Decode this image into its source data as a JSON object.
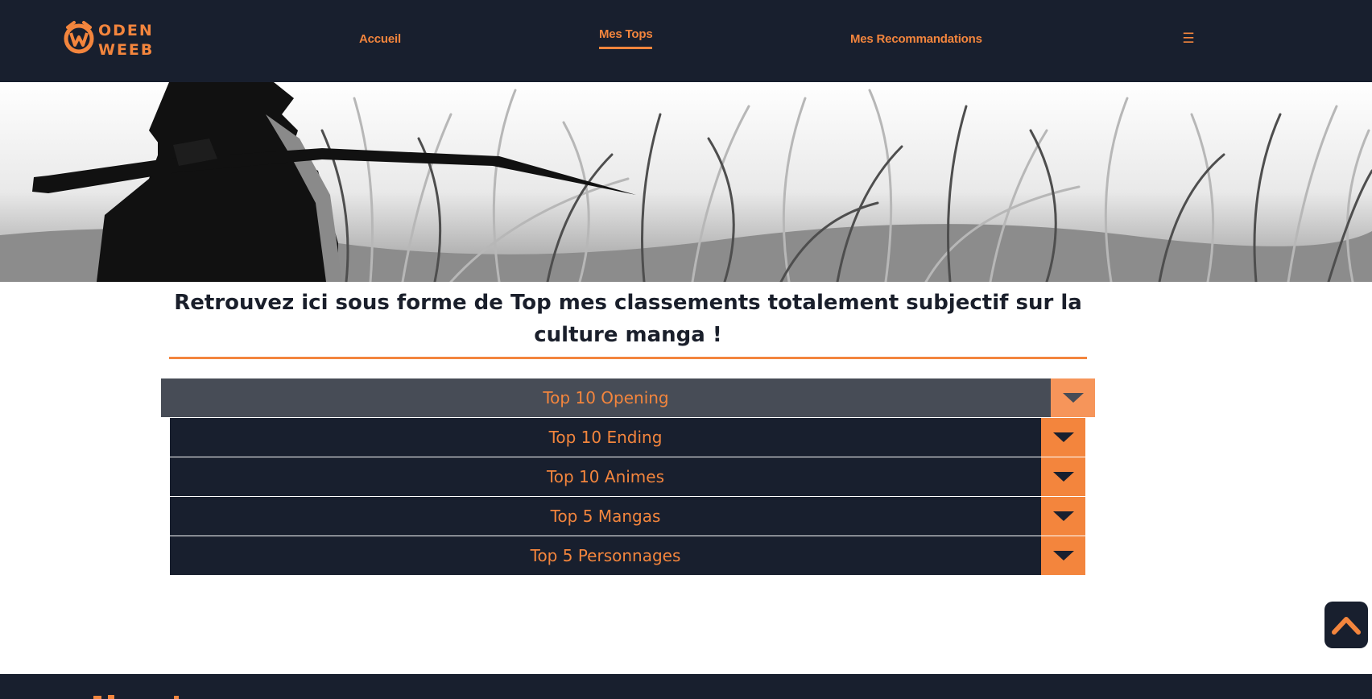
{
  "brand": {
    "name": "ODEN WEEB",
    "logo_line1": "ODEN",
    "logo_line2": "WEEB"
  },
  "nav": {
    "items": [
      {
        "label": "Accueil"
      },
      {
        "label": "Mes Tops",
        "active": true
      },
      {
        "label": "Mes Recommandations"
      }
    ],
    "menu_icon": "hamburger-icon"
  },
  "intro": {
    "text": "Retrouvez ici sous forme de Top mes classements totalement subjectif sur la culture manga !"
  },
  "accordion": {
    "items": [
      {
        "label": "Top 10 Opening",
        "active": true
      },
      {
        "label": "Top 10 Ending"
      },
      {
        "label": "Top 10 Animes"
      },
      {
        "label": "Top 5 Mangas"
      },
      {
        "label": "Top 5 Personnages"
      }
    ],
    "toggle_icon": "caret-down-icon"
  },
  "scroll_top": {
    "icon": "chevron-up-icon"
  },
  "colors": {
    "navy": "#181f2e",
    "orange": "#f3853d",
    "active_row": "#474c56",
    "active_toggle": "#f6955a"
  }
}
